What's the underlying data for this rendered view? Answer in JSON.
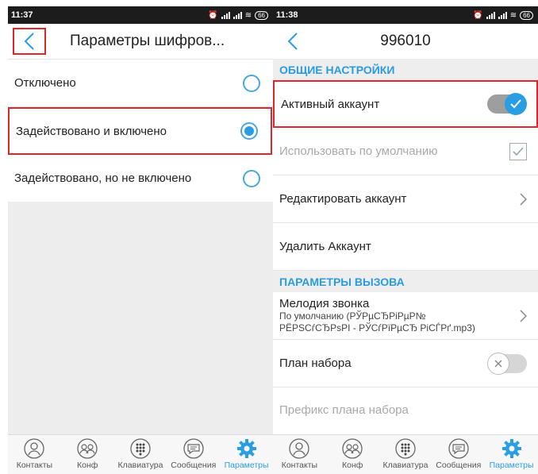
{
  "left": {
    "status_time": "11:37",
    "battery": "66",
    "title": "Параметры шифров...",
    "options": [
      {
        "label": "Отключено",
        "selected": false
      },
      {
        "label": "Задействовано и включено",
        "selected": true
      },
      {
        "label": "Задействовано, но не включено",
        "selected": false
      }
    ]
  },
  "right": {
    "status_time": "11:38",
    "battery": "66",
    "title": "996010",
    "general_section": "ОБЩИЕ НАСТРОЙКИ",
    "active_account": {
      "label": "Активный аккаунт",
      "enabled": true
    },
    "use_default": {
      "label": "Использовать по умолчанию",
      "checked": true
    },
    "edit_account": "Редактировать аккаунт",
    "delete_account": "Удалить Аккаунт",
    "call_section": "ПАРАМЕТРЫ ВЫЗОВА",
    "ringtone": {
      "label": "Мелодия звонка",
      "value_line1": "По умолчанию (РЎРµСЂРіРµР№",
      "value_line2": "РЁРЅСѓСЂРѕРІ - РЎСѓРїРµСЂ РіСЃРґ.mp3)"
    },
    "dial_plan": {
      "label": "План набора",
      "enabled": false
    },
    "dial_prefix": "Префикс плана набора"
  },
  "tabs": [
    {
      "label": "Контакты",
      "icon": "contacts-icon"
    },
    {
      "label": "Конф",
      "icon": "conference-icon"
    },
    {
      "label": "Клавиатура",
      "icon": "keypad-icon"
    },
    {
      "label": "Сообщения",
      "icon": "messages-icon"
    },
    {
      "label": "Параметры",
      "icon": "settings-icon",
      "active": true
    }
  ],
  "colors": {
    "accent": "#2a9ee3",
    "highlight_box": "#e0262a",
    "section_bg": "#eeeeee"
  }
}
